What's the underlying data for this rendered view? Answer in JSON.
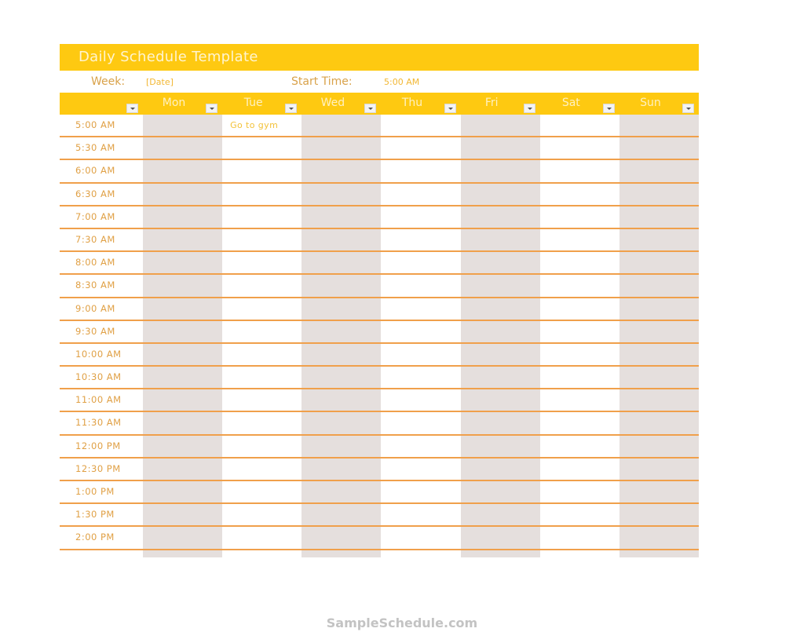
{
  "title": "Daily Schedule Template",
  "info": {
    "week_label": "Week:",
    "week_value": "[Date]",
    "start_label": "Start Time:",
    "start_value": "5:00 AM"
  },
  "days": [
    "Mon",
    "Tue",
    "Wed",
    "Thu",
    "Fri",
    "Sat",
    "Sun"
  ],
  "times": [
    "5:00 AM",
    "5:30 AM",
    "6:00 AM",
    "6:30 AM",
    "7:00 AM",
    "7:30 AM",
    "8:00 AM",
    "8:30 AM",
    "9:00 AM",
    "9:30 AM",
    "10:00 AM",
    "10:30 AM",
    "11:00 AM",
    "11:30 AM",
    "12:00 PM",
    "12:30 PM",
    "1:00 PM",
    "1:30 PM",
    "2:00 PM"
  ],
  "entries": [
    {
      "time_index": 0,
      "day_index": 1,
      "text": "Go to gym"
    }
  ],
  "colors": {
    "accent": "#fec911",
    "line": "#f0a04b",
    "shade": "#e5dfdd"
  },
  "footer": "SampleSchedule.com"
}
